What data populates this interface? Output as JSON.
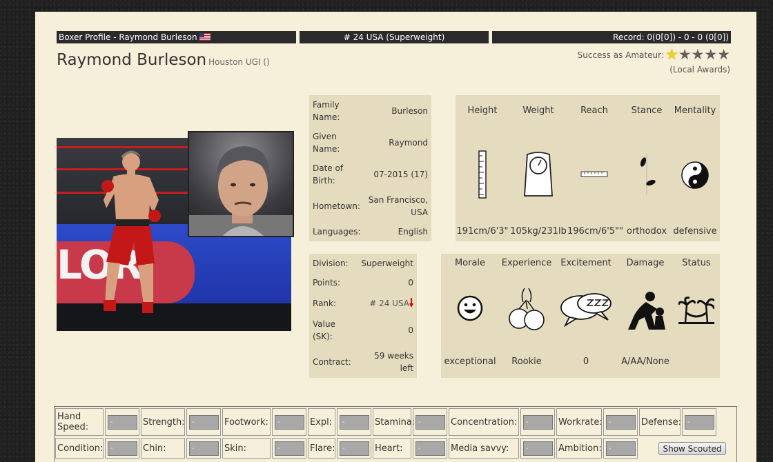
{
  "header": {
    "left": "Boxer Profile - Raymond Burleson",
    "middle": "# 24 USA (Superweight)",
    "right": "Record: 0(0[0]) - 0 - 0 (0[0])"
  },
  "boxer": {
    "name": "Raymond Burleson",
    "subtitle": "Houston UGI ()",
    "amateur_label": "Success as Amateur:",
    "amateur_stars": 1,
    "amateur_stars_max": 5,
    "awards": "(Local Awards)"
  },
  "picture": {
    "banner_text": "LORI"
  },
  "info": [
    {
      "label": "Family Name:",
      "value": "Burleson"
    },
    {
      "label": "Given Name:",
      "value": "Raymond"
    },
    {
      "label": "Date of Birth:",
      "value": "07-2015 (17)"
    },
    {
      "label": "Hometown:",
      "value": "San Francisco, USA"
    },
    {
      "label": "Languages:",
      "value": "English"
    }
  ],
  "rank_info": [
    {
      "label": "Division:",
      "value": "Superweight"
    },
    {
      "label": "Points:",
      "value": "0"
    },
    {
      "label": "Rank:",
      "value": "# 24 USA"
    },
    {
      "label": "Value (SK):",
      "value": "0"
    },
    {
      "label": "Contract:",
      "value": "59 weeks left"
    }
  ],
  "physical": [
    {
      "label": "Height",
      "value": "191cm/6'3\"",
      "icon": "ruler-icon"
    },
    {
      "label": "Weight",
      "value": "105kg/231lb",
      "icon": "scale-icon"
    },
    {
      "label": "Reach",
      "value": "196cm/6'5\"\"",
      "icon": "tape-icon"
    },
    {
      "label": "Stance",
      "value": "orthodox",
      "icon": "footprints-icon"
    },
    {
      "label": "Mentality",
      "value": "defensive",
      "icon": "yin-yang-icon"
    }
  ],
  "status": [
    {
      "label": "Morale",
      "value": "exceptional",
      "icon": "smiley-icon"
    },
    {
      "label": "Experience",
      "value": "Rookie",
      "icon": "gloves-icon"
    },
    {
      "label": "Excitement",
      "value": "0",
      "icon": "speech-bubbles-icon"
    },
    {
      "label": "Damage",
      "value": "A/AA/None",
      "icon": "injury-icon"
    },
    {
      "label": "Status",
      "value": "",
      "icon": "palm-hammock-icon"
    }
  ],
  "scouting": {
    "row1": [
      "Hand Speed:",
      "Strength:",
      "Footwork:",
      "Expl:",
      "Stamina:",
      "Concentration:",
      "Workrate:",
      "Defense:"
    ],
    "row2": [
      "Condition:",
      "Chin:",
      "Skin:",
      "Flare:",
      "Heart:",
      "Media savvy:",
      "Ambition:"
    ],
    "placeholder": "-",
    "button": "Show Scouted"
  },
  "colors": {
    "panel": "#f6efd9",
    "box": "#e5dcc0",
    "bar": "#2a2a2a",
    "star": "#f3d21a"
  }
}
